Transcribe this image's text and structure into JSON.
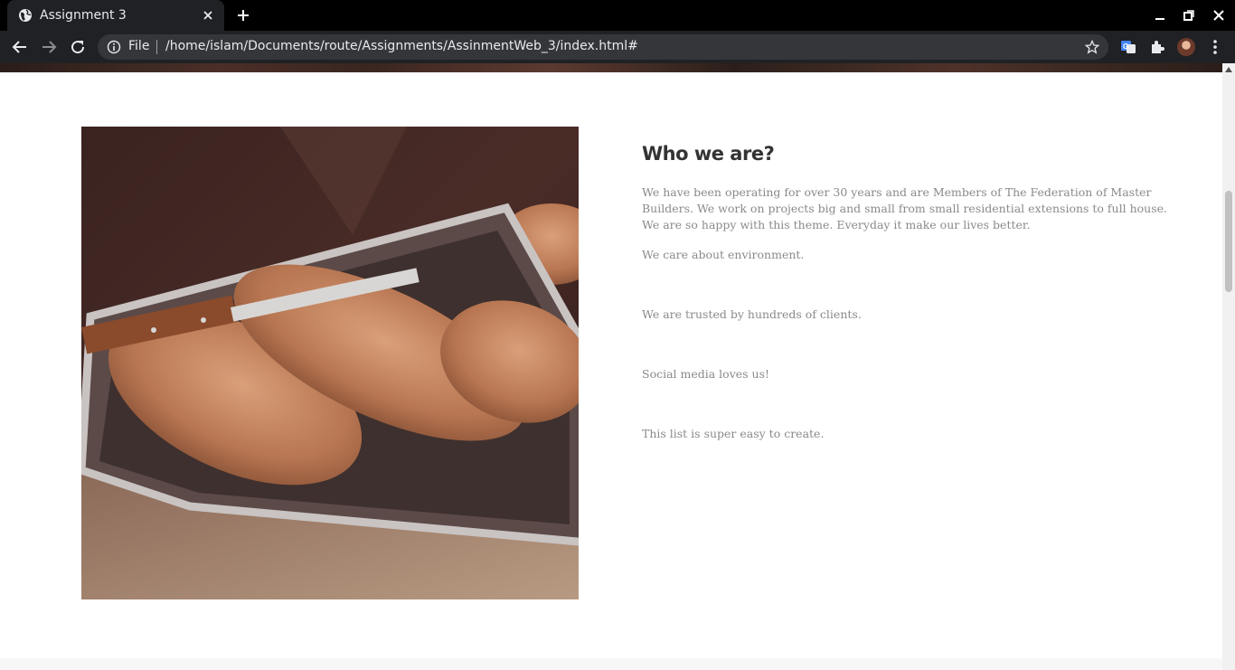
{
  "browser": {
    "tab_title": "Assignment 3",
    "scheme_label": "File",
    "url": "/home/islam/Documents/route/Assignments/AssinmentWeb_3/index.html#"
  },
  "about": {
    "title": "Who we are?",
    "description": "We have been operating for over 30 years and are Members of The Federation of Master Builders. We work on projects big and small from small residential extensions to full house. We are so happy with this theme. Everyday it make our lives better.",
    "points": [
      "We care about environment.",
      "We are trusted by hundreds of clients.",
      "Social media loves us!",
      "This list is super easy to create."
    ]
  }
}
